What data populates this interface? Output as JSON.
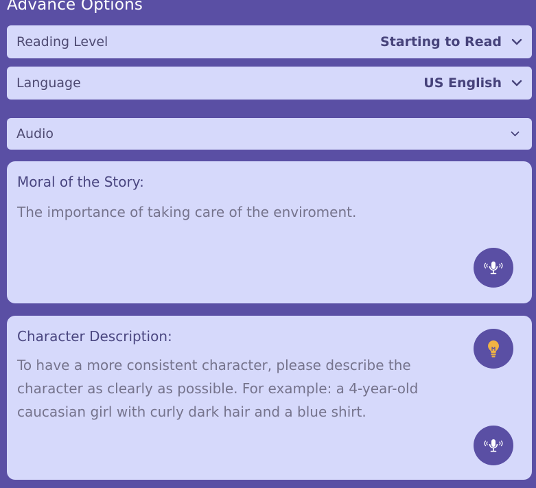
{
  "header": {
    "title": "Advance Options"
  },
  "reading_level": {
    "label": "Reading Level",
    "value": "Starting to Read"
  },
  "language": {
    "label": "Language",
    "value": "US English"
  },
  "audio": {
    "label": "Audio"
  },
  "moral": {
    "title": "Moral of the Story:",
    "text": "The importance of taking care of the enviroment."
  },
  "character": {
    "title": "Character Description:",
    "text": "To have a more consistent character, please describe the character as clearly as possible. For example: a 4-year-old caucasian girl with curly dark hair and a blue shirt."
  },
  "icons": {
    "chevron": "chevron-down-icon",
    "mic": "microphone-icon",
    "bulb": "lightbulb-icon"
  },
  "colors": {
    "background": "#5a4fa4",
    "panel": "#d6d9fb",
    "accent_bulb": "#f0b344"
  }
}
